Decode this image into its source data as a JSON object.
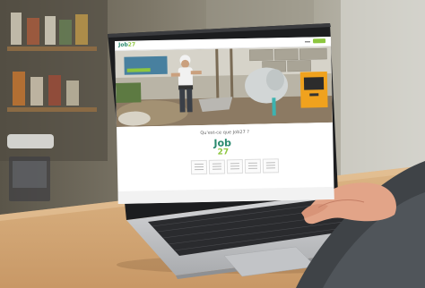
{
  "screen": {
    "nav": {
      "logo_text": "Job",
      "logo_number": "27",
      "menu_items": [
        "",
        ""
      ]
    },
    "hero": {
      "overlay_text": ""
    },
    "question": "Qu'est-ce que Job27 ?",
    "brand": {
      "logo_text": "Job",
      "logo_number": "27"
    },
    "cards": [
      {
        "label": ""
      },
      {
        "label": ""
      },
      {
        "label": ""
      },
      {
        "label": ""
      },
      {
        "label": ""
      }
    ]
  },
  "colors": {
    "brand_green": "#2a8a6e",
    "accent_lime": "#8dc63f",
    "overlay_blue": "#2f6e96",
    "mixer_orange": "#f0a21e",
    "desk_wood": "#d9b07c",
    "laptop_silver": "#c9cacc",
    "sleeve_grey": "#3f4347"
  },
  "icons": [
    "laptop",
    "hand",
    "sleeve",
    "cement-mixer",
    "worker"
  ]
}
